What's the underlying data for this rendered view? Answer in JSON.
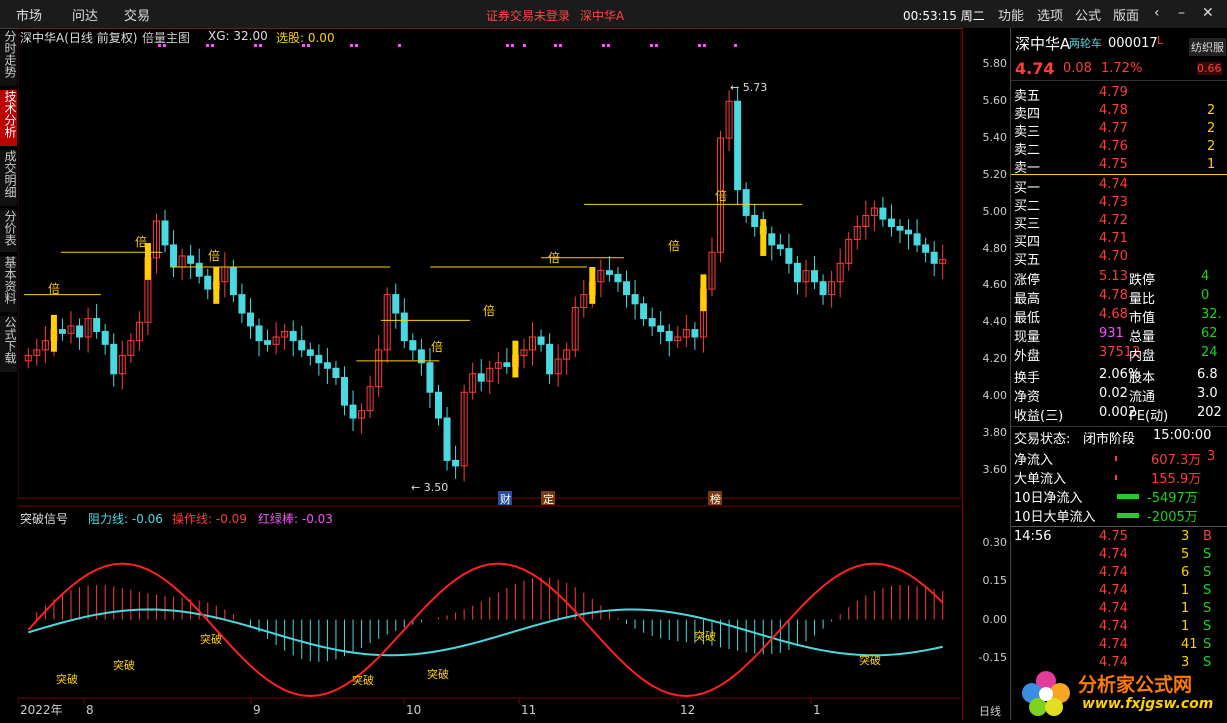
{
  "menu": {
    "items": [
      "市场",
      "问达",
      "交易"
    ],
    "notice": "证券交易未登录",
    "notice_stock": "深中华A",
    "clock": "00:53:15 周二",
    "right_items": [
      "功能",
      "选项",
      "公式",
      "版面"
    ]
  },
  "vtabs": [
    "分时走势",
    "技术分析",
    "成交明细",
    "分价表",
    "基本资料",
    "公式下载"
  ],
  "main_chart": {
    "title": "深中华A(日线 前复权)",
    "indicator": "倍量主图",
    "xg_label": "XG: 32.00",
    "xuangu_label": "选股: 0.00",
    "high_label": "5.73",
    "low_label": "3.50",
    "bei_label": "倍",
    "markers": [
      "财",
      "定",
      "榜"
    ],
    "y_ticks": [
      "5.80",
      "5.60",
      "5.40",
      "5.20",
      "5.00",
      "4.80",
      "4.60",
      "4.40",
      "4.20",
      "4.00",
      "3.80",
      "3.60"
    ]
  },
  "sub_chart": {
    "title": "突破信号",
    "resist": "阻力线: -0.06",
    "operate": "操作线: -0.09",
    "redgreen": "红绿棒: -0.03",
    "break_label": "突破",
    "y_ticks": [
      "0.30",
      "0.15",
      "0.00",
      "-0.15"
    ]
  },
  "x_axis": {
    "labels": [
      "2022年",
      "8",
      "9",
      "10",
      "11",
      "12",
      "1"
    ],
    "period": "日线"
  },
  "chart_data": {
    "type": "candlestick",
    "title": "深中华A(日线 前复权)",
    "ylim": [
      3.5,
      5.9
    ],
    "high": 5.73,
    "low": 3.5,
    "threshold_lines": [
      4.55,
      4.78,
      4.7,
      4.19,
      4.41,
      4.7,
      4.75,
      5.04
    ],
    "close_series": [
      4.22,
      4.25,
      4.3,
      4.36,
      4.34,
      4.38,
      4.32,
      4.42,
      4.35,
      4.28,
      4.12,
      4.22,
      4.3,
      4.4,
      4.75,
      4.95,
      4.82,
      4.7,
      4.76,
      4.72,
      4.65,
      4.58,
      4.62,
      4.7,
      4.55,
      4.45,
      4.38,
      4.3,
      4.28,
      4.32,
      4.35,
      4.3,
      4.25,
      4.22,
      4.18,
      4.15,
      4.1,
      3.95,
      3.88,
      3.92,
      4.05,
      4.25,
      4.55,
      4.45,
      4.3,
      4.25,
      4.18,
      4.02,
      3.88,
      3.65,
      3.62,
      4.02,
      4.12,
      4.08,
      4.15,
      4.18,
      4.16,
      4.22,
      4.25,
      4.32,
      4.28,
      4.12,
      4.2,
      4.25,
      4.48,
      4.55,
      4.62,
      4.68,
      4.66,
      4.62,
      4.55,
      4.5,
      4.42,
      4.38,
      4.35,
      4.3,
      4.32,
      4.36,
      4.32,
      4.58,
      4.78,
      5.4,
      5.6,
      5.12,
      4.98,
      4.92,
      4.88,
      4.82,
      4.8,
      4.72,
      4.62,
      4.68,
      4.62,
      4.55,
      4.62,
      4.72,
      4.85,
      4.92,
      4.98,
      5.02,
      4.96,
      4.92,
      4.9,
      4.88,
      4.82,
      4.78,
      4.72,
      4.74
    ]
  },
  "quote": {
    "name": "深中华A",
    "badge": "两轮车",
    "code": "000017",
    "flag": "L",
    "industry": "纺织服",
    "price": "4.74",
    "change": "0.08",
    "pct": "1.72%",
    "pct_right": "0.66",
    "sells": [
      {
        "label": "卖五",
        "price": "4.79",
        "vol": ""
      },
      {
        "label": "卖四",
        "price": "4.78",
        "vol": "2"
      },
      {
        "label": "卖三",
        "price": "4.77",
        "vol": "2"
      },
      {
        "label": "卖二",
        "price": "4.76",
        "vol": "2"
      },
      {
        "label": "卖一",
        "price": "4.75",
        "vol": "1"
      }
    ],
    "buys": [
      {
        "label": "买一",
        "price": "4.74"
      },
      {
        "label": "买二",
        "price": "4.73"
      },
      {
        "label": "买三",
        "price": "4.72"
      },
      {
        "label": "买四",
        "price": "4.71"
      },
      {
        "label": "买五",
        "price": "4.70"
      }
    ],
    "stats": [
      {
        "l": "涨停",
        "v": "5.13",
        "l2": "跌停",
        "v2": "4"
      },
      {
        "l": "最高",
        "v": "4.78",
        "l2": "量比",
        "v2": "0"
      },
      {
        "l": "最低",
        "v": "4.68",
        "l2": "市值",
        "v2": "32."
      },
      {
        "l": "现量",
        "v": "931",
        "l2": "总量",
        "v2": "62"
      },
      {
        "l": "外盘",
        "v": "37512",
        "l2": "内盘",
        "v2": "24"
      }
    ],
    "stats2": [
      {
        "l": "换手",
        "v": "2.06%",
        "l2": "股本",
        "v2": "6.8"
      },
      {
        "l": "净资",
        "v": "0.02",
        "l2": "流通",
        "v2": "3.0"
      },
      {
        "l": "收益(三)",
        "v": "0.002",
        "l2": "PE(动)",
        "v2": "202"
      }
    ],
    "trade_status_label": "交易状态:",
    "trade_status": "闭市阶段",
    "trade_time": "15:00:00",
    "flows": [
      {
        "l": "净流入",
        "v": "607.3万",
        "m": "3"
      },
      {
        "l": "大单流入",
        "v": "155.9万",
        "m": ""
      },
      {
        "l": "10日净流入",
        "v": "-5497万",
        "m": ""
      },
      {
        "l": "10日大单流入",
        "v": "-2005万",
        "m": ""
      }
    ],
    "ticks": [
      {
        "t": "14:56",
        "p": "4.75",
        "v": "3",
        "s": "B"
      },
      {
        "t": "",
        "p": "4.74",
        "v": "5",
        "s": "S"
      },
      {
        "t": "",
        "p": "4.74",
        "v": "6",
        "s": "S"
      },
      {
        "t": "",
        "p": "4.74",
        "v": "1",
        "s": "S"
      },
      {
        "t": "",
        "p": "4.74",
        "v": "1",
        "s": "S"
      },
      {
        "t": "",
        "p": "4.74",
        "v": "1",
        "s": "S"
      },
      {
        "t": "",
        "p": "4.74",
        "v": "41",
        "s": "S"
      },
      {
        "t": "",
        "p": "4.74",
        "v": "3",
        "s": "S"
      }
    ]
  },
  "logo": {
    "text": "分析家公式网",
    "url": "www.fxjgsw.com"
  },
  "colors": {
    "up": "#ff3b3b",
    "down": "#4ad9e0",
    "yellow": "#ffd000",
    "bg": "#000000"
  }
}
